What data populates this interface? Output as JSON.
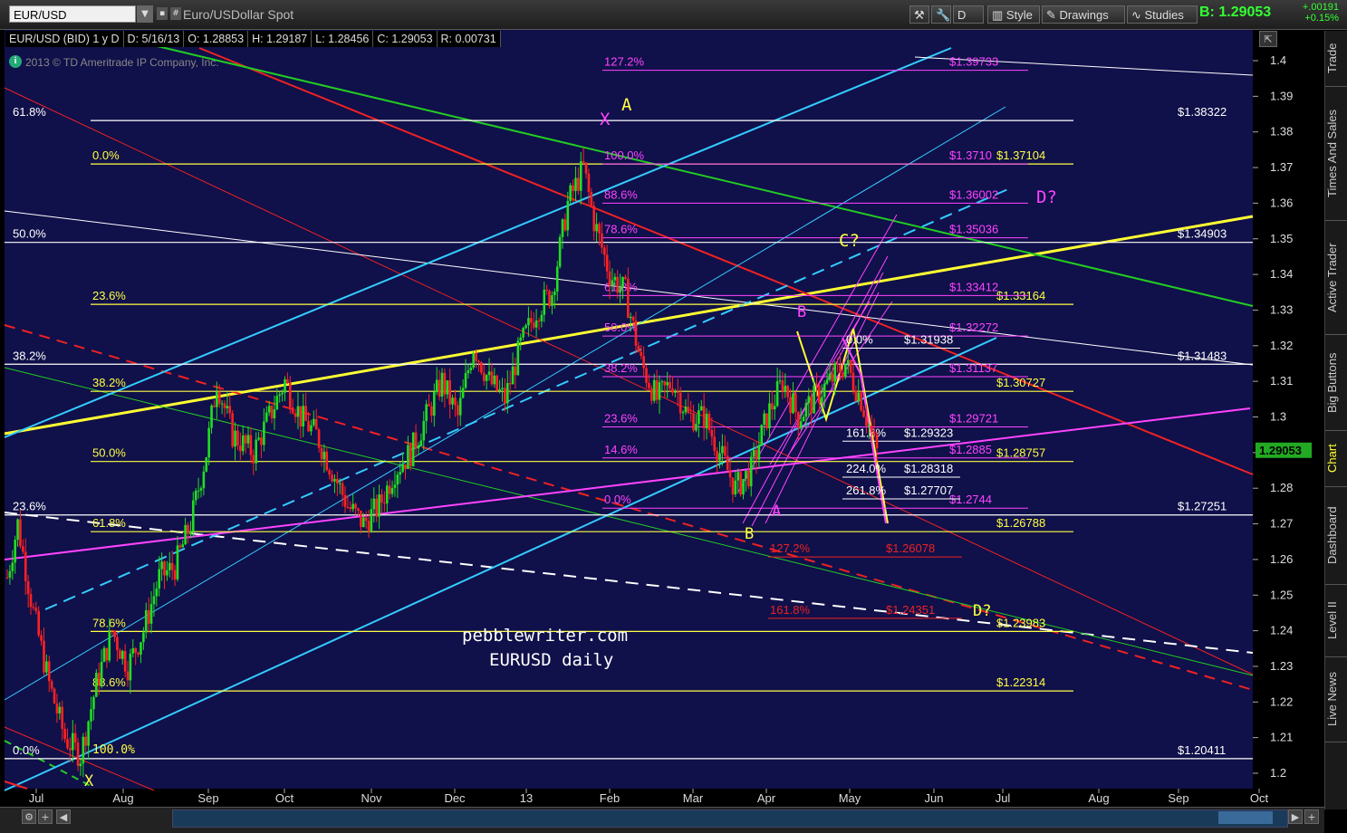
{
  "toolbar": {
    "symbol": "EUR/USD",
    "description": "Euro/USDollar Spot",
    "style_label": "Style",
    "drawings_label": "Drawings",
    "studies_label": "Studies",
    "bid_label": "B:",
    "bid_value": "1.29053",
    "change_abs": "+.00191",
    "change_pct": "+0.15%"
  },
  "infobar": {
    "symbol_period": "EUR/USD (BID) 1 y D",
    "date": "D: 5/16/13",
    "open": "O: 1.28853",
    "high": "H: 1.29187",
    "low": "L: 1.28456",
    "close": "C: 1.29053",
    "range": "R: 0.00731"
  },
  "copyright": "2013 © TD Ameritrade IP Company, Inc.",
  "sidebar_tabs": [
    "Trade",
    "Times And Sales",
    "Active Trader",
    "Big Buttons",
    "Chart",
    "Dashboard",
    "Level II",
    "Live News"
  ],
  "active_tab": "Chart",
  "watermark": {
    "line1": "pebblewriter.com",
    "line2": "EURUSD daily"
  },
  "chart_data": {
    "type": "candlestick",
    "title": "EUR/USD (BID) 1 y D",
    "x_labels": [
      "Jul",
      "Aug",
      "Sep",
      "Oct",
      "Nov",
      "Dec",
      "13",
      "Feb",
      "Mar",
      "Apr",
      "May",
      "Jun",
      "Jul",
      "Aug",
      "Sep",
      "Oct"
    ],
    "y_ticks": [
      1.2,
      1.21,
      1.22,
      1.23,
      1.24,
      1.25,
      1.26,
      1.27,
      1.28,
      1.29,
      1.3,
      1.31,
      1.32,
      1.33,
      1.34,
      1.35,
      1.36,
      1.37,
      1.38,
      1.39,
      1.4
    ],
    "ylim": [
      1.195,
      1.405
    ],
    "last_price": "1.29053",
    "price_path": [
      [
        0,
        1.255
      ],
      [
        2,
        1.27
      ],
      [
        5,
        1.245
      ],
      [
        8,
        1.225
      ],
      [
        11,
        1.21
      ],
      [
        14,
        1.205
      ],
      [
        17,
        1.225
      ],
      [
        20,
        1.24
      ],
      [
        23,
        1.23
      ],
      [
        26,
        1.24
      ],
      [
        29,
        1.255
      ],
      [
        32,
        1.258
      ],
      [
        35,
        1.27
      ],
      [
        38,
        1.29
      ],
      [
        40,
        1.31
      ],
      [
        43,
        1.295
      ],
      [
        47,
        1.29
      ],
      [
        50,
        1.3
      ],
      [
        53,
        1.31
      ],
      [
        56,
        1.3
      ],
      [
        59,
        1.295
      ],
      [
        62,
        1.285
      ],
      [
        65,
        1.275
      ],
      [
        68,
        1.27
      ],
      [
        71,
        1.275
      ],
      [
        74,
        1.285
      ],
      [
        77,
        1.29
      ],
      [
        80,
        1.3
      ],
      [
        83,
        1.31
      ],
      [
        86,
        1.3
      ],
      [
        89,
        1.32
      ],
      [
        92,
        1.31
      ],
      [
        95,
        1.305
      ],
      [
        98,
        1.32
      ],
      [
        101,
        1.33
      ],
      [
        104,
        1.335
      ],
      [
        107,
        1.36
      ],
      [
        110,
        1.37
      ],
      [
        112,
        1.355
      ],
      [
        115,
        1.34
      ],
      [
        118,
        1.335
      ],
      [
        121,
        1.315
      ],
      [
        124,
        1.305
      ],
      [
        127,
        1.31
      ],
      [
        130,
        1.3
      ],
      [
        133,
        1.3
      ],
      [
        136,
        1.29
      ],
      [
        139,
        1.28
      ],
      [
        142,
        1.285
      ],
      [
        145,
        1.3
      ],
      [
        148,
        1.31
      ],
      [
        151,
        1.3
      ],
      [
        154,
        1.305
      ],
      [
        157,
        1.31
      ],
      [
        160,
        1.315
      ],
      [
        163,
        1.305
      ],
      [
        166,
        1.29
      ]
    ],
    "levels": [
      {
        "label": "61.8%",
        "price": 1.3832,
        "price_label": "$1.38322",
        "color": "#ffffff",
        "label_color": "#ffffff"
      },
      {
        "label": "0.0%",
        "price": 1.371,
        "price_label": "$1.37104",
        "color": "#ffff44",
        "label_color": "#ffff44"
      },
      {
        "label": "50.0%",
        "price": 1.349,
        "price_label": "$1.34903",
        "color": "#ffffff",
        "label_color": "#ffffff"
      },
      {
        "label": "23.6%",
        "price": 1.3316,
        "price_label": "$1.33164",
        "color": "#ffff44",
        "label_color": "#ffff44"
      },
      {
        "label": "38.2%",
        "price": 1.3148,
        "price_label": "$1.31483",
        "color": "#ffffff",
        "label_color": "#ffffff"
      },
      {
        "label": "38.2%",
        "price": 1.3072,
        "price_label": "$1.30727",
        "color": "#ffff44",
        "label_color": "#ffff44"
      },
      {
        "label": "50.0%",
        "price": 1.2875,
        "price_label": "$1.28757",
        "color": "#ffff44",
        "label_color": "#ffff44"
      },
      {
        "label": "23.6%",
        "price": 1.2725,
        "price_label": "$1.27251",
        "color": "#ffffff",
        "label_color": "#ffffff"
      },
      {
        "label": "61.8%",
        "price": 1.2678,
        "price_label": "$1.26788",
        "color": "#ffff44",
        "label_color": "#ffff44"
      },
      {
        "label": "78.6%",
        "price": 1.2398,
        "price_label": "$1.23983",
        "color": "#ffff44",
        "label_color": "#ffff44"
      },
      {
        "label": "88.6%",
        "price": 1.2231,
        "price_label": "$1.22314",
        "color": "#ffff44",
        "label_color": "#ffff44"
      },
      {
        "label": "0.0%",
        "price": 1.2041,
        "price_label": "$1.20411",
        "color": "#ffffff",
        "label_color": "#ffffff"
      }
    ],
    "pink_levels": [
      {
        "label": "127.2%",
        "price": 1.3973,
        "price_label": "$1.39733"
      },
      {
        "label": "100.0%",
        "price": 1.371,
        "price_label": "$1.3710"
      },
      {
        "label": "88.6%",
        "price": 1.36,
        "price_label": "$1.36002"
      },
      {
        "label": "78.6%",
        "price": 1.3503,
        "price_label": "$1.35036"
      },
      {
        "label": "61.8%",
        "price": 1.3341,
        "price_label": "$1.33412"
      },
      {
        "label": "50.0%",
        "price": 1.3227,
        "price_label": "$1.32272"
      },
      {
        "label": "38.2%",
        "price": 1.3113,
        "price_label": "$1.31137"
      },
      {
        "label": "23.6%",
        "price": 1.2972,
        "price_label": "$1.29721"
      },
      {
        "label": "14.6%",
        "price": 1.2885,
        "price_label": "$1.2885"
      },
      {
        "label": "0.0%",
        "price": 1.2744,
        "price_label": "$1.2744"
      }
    ],
    "red_levels": [
      {
        "label": "127.2%",
        "price": 1.2607,
        "price_label": "$1.26078"
      },
      {
        "label": "161.8%",
        "price": 1.2435,
        "price_label": "$1.24351"
      }
    ],
    "white_levels": [
      {
        "label": "0.0%",
        "price": 1.3193,
        "price_label": "$1.31938"
      },
      {
        "label": "161.8%",
        "price": 1.2932,
        "price_label": "$1.29323"
      },
      {
        "label": "224.0%",
        "price": 1.2831,
        "price_label": "$1.28318"
      },
      {
        "label": "261.8%",
        "price": 1.277,
        "price_label": "$1.27707"
      }
    ],
    "annotations": [
      {
        "text": "A",
        "color": "#ffff44"
      },
      {
        "text": "X",
        "color": "#ff44ff"
      },
      {
        "text": "D?",
        "color": "#ff44ff"
      },
      {
        "text": "C?",
        "color": "#ffff44"
      },
      {
        "text": "B",
        "color": "#ff44ff"
      },
      {
        "text": "A",
        "color": "#ff44ff"
      },
      {
        "text": "B",
        "color": "#ffff44"
      },
      {
        "text": "D?",
        "color": "#ffff44"
      },
      {
        "text": "X",
        "color": "#ffff44"
      },
      {
        "text": "100.0%",
        "color": "#ffff44"
      }
    ]
  },
  "colors": {
    "plot_bg": "#10104a",
    "up": "#22dd22",
    "down": "#ff2222",
    "cyan": "#33ccff",
    "yellow": "#ffff33",
    "magenta": "#ff44ff",
    "green": "#22cc22",
    "red": "#ee2222"
  }
}
